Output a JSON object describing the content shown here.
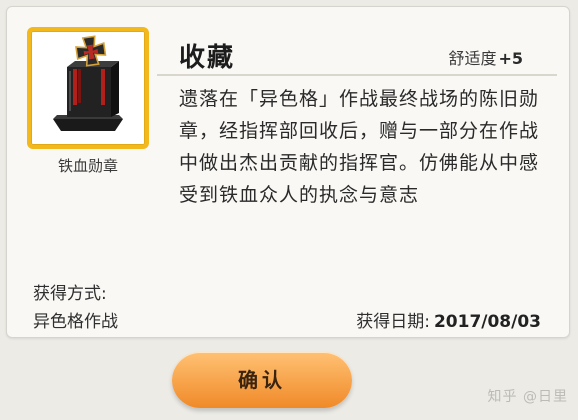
{
  "item": {
    "name": "铁血勋章",
    "icon": "iron-blood-medal-icon"
  },
  "header": {
    "title": "收藏",
    "comfort_label": "舒适度",
    "comfort_value": "+5"
  },
  "description": "遗落在「异色格」作战最终战场的陈旧勋章，经指挥部回收后，赠与一部分在作战中做出杰出贡献的指挥官。仿佛能从中感受到铁血众人的执念与意志",
  "obtain": {
    "label": "获得方式:",
    "value": "异色格作战"
  },
  "date": {
    "label": "获得日期:",
    "value": "2017/08/03"
  },
  "actions": {
    "confirm_label": "确认"
  },
  "watermark": "知乎 @日里",
  "colors": {
    "frame_border": "#f2b81c",
    "button_top": "#ffc174",
    "button_bottom": "#f08a28",
    "background": "#ecebe6"
  }
}
